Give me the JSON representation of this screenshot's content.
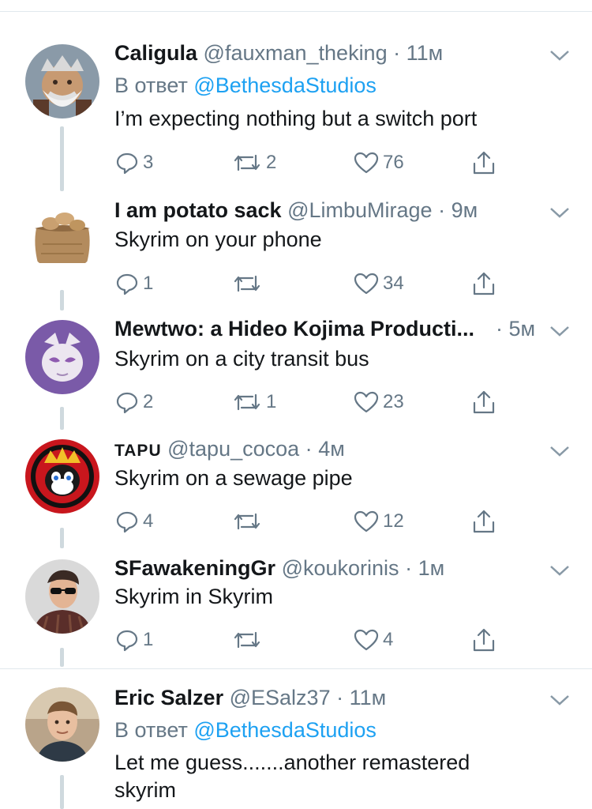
{
  "colors": {
    "accent": "#1da1f2",
    "muted": "#657786",
    "text": "#14171a",
    "divider": "#e1e8ed"
  },
  "tweets": [
    {
      "name": "Caligula",
      "handle": "@fauxman_theking",
      "time": "11м",
      "reply_prefix": "В ответ",
      "reply_to": "@BethesdaStudios",
      "text": "I’m expecting nothing but a switch port",
      "replies": "3",
      "retweets": "2",
      "likes": "76",
      "avatar": "caligula-avatar"
    },
    {
      "name": "I am potato sack",
      "handle": "@LimbuMirage",
      "time": "9м",
      "text": "Skyrim on your phone",
      "replies": "1",
      "retweets": "",
      "likes": "34",
      "avatar": "potato-sack-avatar"
    },
    {
      "name": "Mewtwo: a Hideo Kojima Producti...",
      "handle": "",
      "time": "5м",
      "text": "Skyrim on a city transit bus",
      "replies": "2",
      "retweets": "1",
      "likes": "23",
      "avatar": "mewtwo-avatar"
    },
    {
      "name": "TAPU",
      "handle": "@tapu_cocoa",
      "time": "4м",
      "text": "Skyrim on a sewage pipe",
      "replies": "4",
      "retweets": "",
      "likes": "12",
      "avatar": "tapu-avatar"
    },
    {
      "name": "SFawakeningGr",
      "handle": "@koukorinis",
      "time": "1м",
      "text": "Skyrim in Skyrim",
      "replies": "1",
      "retweets": "",
      "likes": "4",
      "avatar": "sfawakening-avatar"
    },
    {
      "name": "Eric Salzer",
      "handle": "@ESalz37",
      "time": "11м",
      "reply_prefix": "В ответ",
      "reply_to": "@BethesdaStudios",
      "text": "Let me guess.......another remastered skyrim",
      "avatar": "eric-avatar"
    }
  ]
}
